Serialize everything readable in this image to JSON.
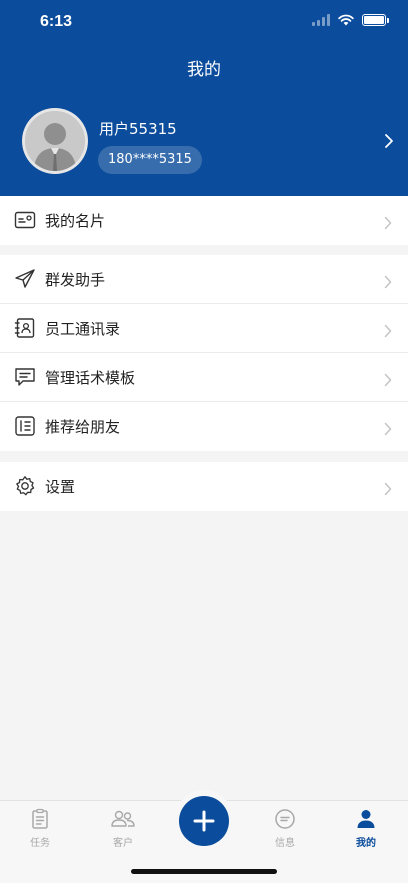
{
  "status_bar": {
    "time": "6:13"
  },
  "header": {
    "title": "我的"
  },
  "profile": {
    "name": "用户55315",
    "phone": "180****5315"
  },
  "menu_groups": [
    {
      "items": [
        {
          "label": "我的名片",
          "icon": "business-card-icon"
        }
      ]
    },
    {
      "items": [
        {
          "label": "群发助手",
          "icon": "paper-plane-icon"
        },
        {
          "label": "员工通讯录",
          "icon": "contacts-book-icon"
        },
        {
          "label": "管理话术模板",
          "icon": "chat-bubble-icon"
        },
        {
          "label": "推荐给朋友",
          "icon": "recommend-card-icon"
        }
      ]
    },
    {
      "items": [
        {
          "label": "设置",
          "icon": "gear-icon"
        }
      ]
    }
  ],
  "tabbar": {
    "tabs": [
      {
        "label": "任务",
        "icon": "clipboard-icon",
        "active": false
      },
      {
        "label": "客户",
        "icon": "users-icon",
        "active": false
      },
      {
        "label": "信息",
        "icon": "message-icon",
        "active": false
      },
      {
        "label": "我的",
        "icon": "person-icon",
        "active": true
      }
    ]
  },
  "colors": {
    "primary": "#0b4c9c",
    "background": "#f4f4f4",
    "tab_inactive": "#a8a8a8"
  }
}
